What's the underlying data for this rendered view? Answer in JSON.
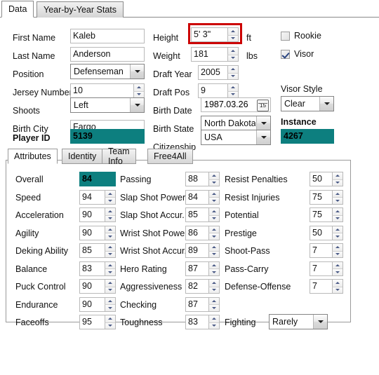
{
  "outer_tabs": [
    {
      "label": "Data",
      "active": true
    },
    {
      "label": "Year-by-Year Stats",
      "active": false
    }
  ],
  "form": {
    "left_column": [
      {
        "label": "First Name",
        "type": "textbox",
        "value": "Kaleb"
      },
      {
        "label": "Last Name",
        "type": "textbox",
        "value": "Anderson"
      },
      {
        "label": "Position",
        "type": "combobox",
        "value": "Defenseman"
      },
      {
        "label": "Jersey Number",
        "type": "spinner",
        "value": "10"
      },
      {
        "label": "Shoots",
        "type": "combobox",
        "value": "Left"
      },
      {
        "label": "Birth City",
        "type": "textbox",
        "value": "Fargo"
      },
      {
        "label": "Player ID",
        "type": "teal",
        "value": "5139",
        "bold_label": true
      }
    ],
    "middle_column": [
      {
        "label": "Height",
        "type": "spinner",
        "value": "5' 3\"",
        "unit": "ft",
        "highlighted": true
      },
      {
        "label": "Weight",
        "type": "spinner",
        "value": "181",
        "unit": "lbs"
      },
      {
        "label": "Draft Year",
        "type": "spinner",
        "value": "2005",
        "unit": ""
      },
      {
        "label": "Draft Pos",
        "type": "spinner",
        "value": "9",
        "unit": ""
      },
      {
        "label": "Birth Date",
        "type": "datepicker",
        "value": "1987.03.26"
      },
      {
        "label": "Birth State",
        "type": "combobox",
        "value": "North Dakota"
      },
      {
        "label": "Citizenship",
        "type": "combobox",
        "value": "USA"
      }
    ],
    "right_column": {
      "rookie_checkbox": {
        "label": "Rookie",
        "checked": false
      },
      "visor_checkbox": {
        "label": "Visor",
        "checked": true
      },
      "visor_style_label": "Visor Style",
      "visor_style_value": "Clear",
      "instance_label": "Instance",
      "instance_value": "4267"
    }
  },
  "inner_tabs": [
    {
      "label": "Attributes",
      "active": true
    },
    {
      "label": "Identity",
      "active": false
    },
    {
      "label": "Team Info",
      "active": false
    },
    {
      "label": "Free4All",
      "active": false
    }
  ],
  "attributes": {
    "col1": [
      {
        "label": "Overall",
        "value": "84",
        "type": "teal"
      },
      {
        "label": "Speed",
        "value": "94",
        "type": "spinner"
      },
      {
        "label": "Acceleration",
        "value": "90",
        "type": "spinner"
      },
      {
        "label": "Agility",
        "value": "90",
        "type": "spinner"
      },
      {
        "label": "Deking Ability",
        "value": "85",
        "type": "spinner"
      },
      {
        "label": "Balance",
        "value": "83",
        "type": "spinner"
      },
      {
        "label": "Puck Control",
        "value": "90",
        "type": "spinner"
      },
      {
        "label": "Endurance",
        "value": "90",
        "type": "spinner"
      },
      {
        "label": "Faceoffs",
        "value": "95",
        "type": "spinner"
      }
    ],
    "col2": [
      {
        "label": "Passing",
        "value": "88",
        "type": "spinner"
      },
      {
        "label": "Slap Shot Power",
        "value": "84",
        "type": "spinner"
      },
      {
        "label": "Slap Shot Accur.",
        "value": "85",
        "type": "spinner"
      },
      {
        "label": "Wrist Shot Power",
        "value": "86",
        "type": "spinner"
      },
      {
        "label": "Wrist Shot Accur.",
        "value": "89",
        "type": "spinner"
      },
      {
        "label": "Hero Rating",
        "value": "87",
        "type": "spinner"
      },
      {
        "label": "Aggressiveness",
        "value": "82",
        "type": "spinner"
      },
      {
        "label": "Checking",
        "value": "87",
        "type": "spinner"
      },
      {
        "label": "Toughness",
        "value": "83",
        "type": "spinner"
      }
    ],
    "col3": [
      {
        "label": "Resist Penalties",
        "value": "50",
        "type": "spinner"
      },
      {
        "label": "Resist Injuries",
        "value": "75",
        "type": "spinner"
      },
      {
        "label": "Potential",
        "value": "75",
        "type": "spinner"
      },
      {
        "label": "Prestige",
        "value": "50",
        "type": "spinner"
      },
      {
        "label": "Shoot-Pass",
        "value": "7",
        "type": "spinner"
      },
      {
        "label": "Pass-Carry",
        "value": "7",
        "type": "spinner"
      },
      {
        "label": "Defense-Offense",
        "value": "7",
        "type": "spinner"
      },
      {
        "label": "Fighting",
        "value": "Rarely",
        "type": "combobox"
      }
    ]
  },
  "colors": {
    "teal_field": "#0d7f7f",
    "highlight_red": "#cc0000",
    "tab_border": "#8a8a8a",
    "panel_border": "#9a9a9a"
  }
}
